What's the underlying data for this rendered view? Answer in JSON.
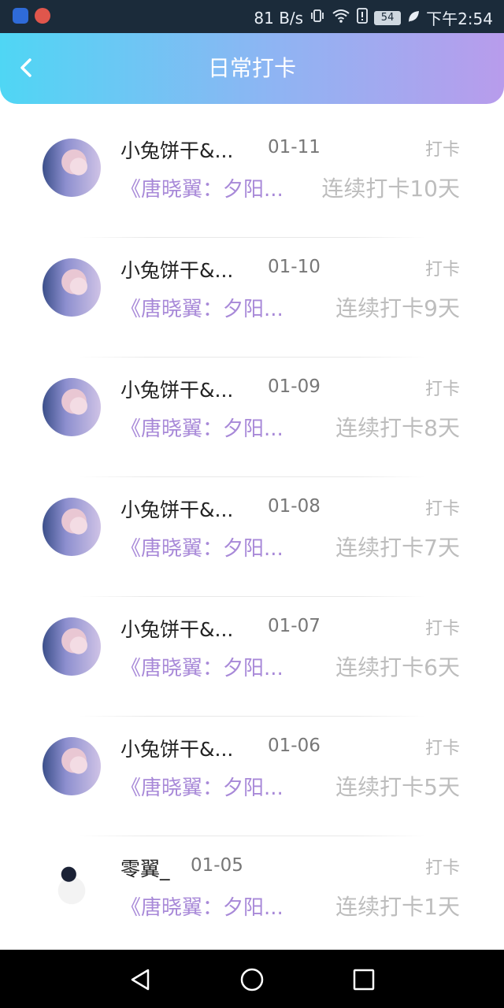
{
  "status_bar": {
    "speed": "81 B/s",
    "battery": "54",
    "time": "下午2:54",
    "icons": [
      "vibrate-icon",
      "wifi-icon",
      "alert-icon",
      "leaf-icon"
    ]
  },
  "header": {
    "title": "日常打卡",
    "back_icon": "chevron-left-icon",
    "gradient": [
      "#4fd6f4",
      "#b89cec"
    ]
  },
  "entries": [
    {
      "username": "小兔饼干&...",
      "date": "01-11",
      "action": "打卡",
      "book": "《唐晓翼：夕阳...",
      "streak": "连续打卡10天"
    },
    {
      "username": "小兔饼干&...",
      "date": "01-10",
      "action": "打卡",
      "book": "《唐晓翼：夕阳...",
      "streak": "连续打卡9天"
    },
    {
      "username": "小兔饼干&...",
      "date": "01-09",
      "action": "打卡",
      "book": "《唐晓翼：夕阳...",
      "streak": "连续打卡8天"
    },
    {
      "username": "小兔饼干&...",
      "date": "01-08",
      "action": "打卡",
      "book": "《唐晓翼：夕阳...",
      "streak": "连续打卡7天"
    },
    {
      "username": "小兔饼干&...",
      "date": "01-07",
      "action": "打卡",
      "book": "《唐晓翼：夕阳...",
      "streak": "连续打卡6天"
    },
    {
      "username": "小兔饼干&...",
      "date": "01-06",
      "action": "打卡",
      "book": "《唐晓翼：夕阳...",
      "streak": "连续打卡5天"
    },
    {
      "username": "零翼_",
      "date": "01-05",
      "action": "打卡",
      "book": "《唐晓翼：夕阳...",
      "streak": "连续打卡1天"
    }
  ],
  "nav_bar": {
    "buttons": [
      "back-triangle-icon",
      "home-circle-icon",
      "recents-square-icon"
    ]
  }
}
